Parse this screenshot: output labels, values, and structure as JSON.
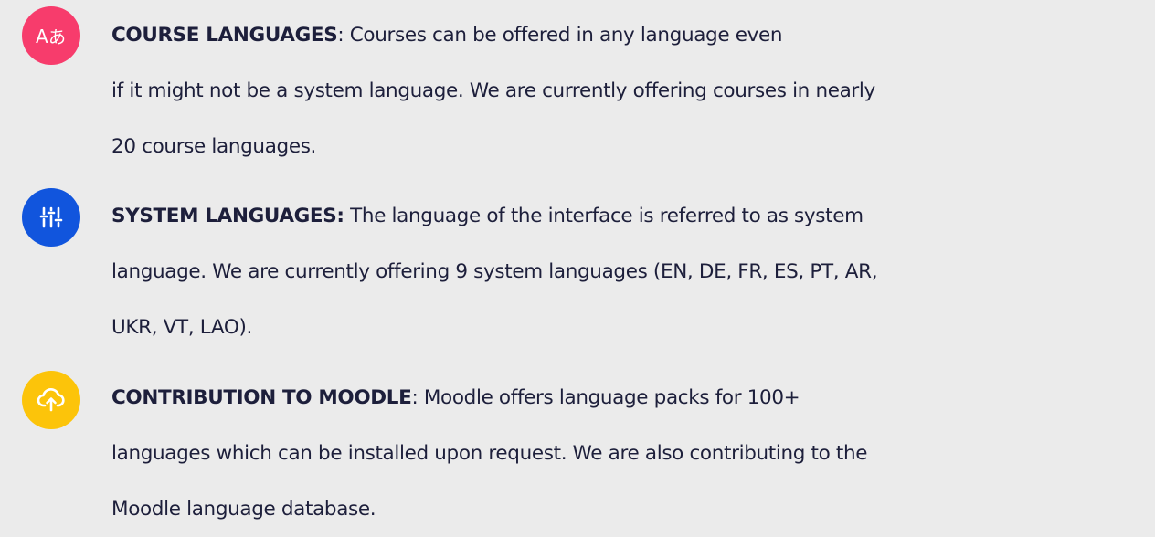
{
  "items": [
    {
      "icon": "translate-icon",
      "icon_color": "#f73c6c",
      "title": "COURSE LANGUAGES",
      "separator": ":",
      "lines": [
        " Courses can be offered in any language even",
        "if it might not be a system language. We are currently offering courses in nearly",
        "20 course languages."
      ]
    },
    {
      "icon": "sliders-icon",
      "icon_color": "#1155dd",
      "title": "SYSTEM LANGUAGES:",
      "separator": "",
      "lines": [
        " The language of the interface is referred to as system",
        "language. We are currently offering 9 system languages (EN, DE, FR, ES, PT, AR,",
        "UKR, VT, LAO)."
      ]
    },
    {
      "icon": "cloud-upload-icon",
      "icon_color": "#fcc40a",
      "title": "CONTRIBUTION TO MOODLE",
      "separator": ":",
      "lines": [
        " Moodle offers language packs for 100+",
        "languages which can be installed upon request. We are also contributing to the",
        "Moodle language database."
      ]
    }
  ]
}
